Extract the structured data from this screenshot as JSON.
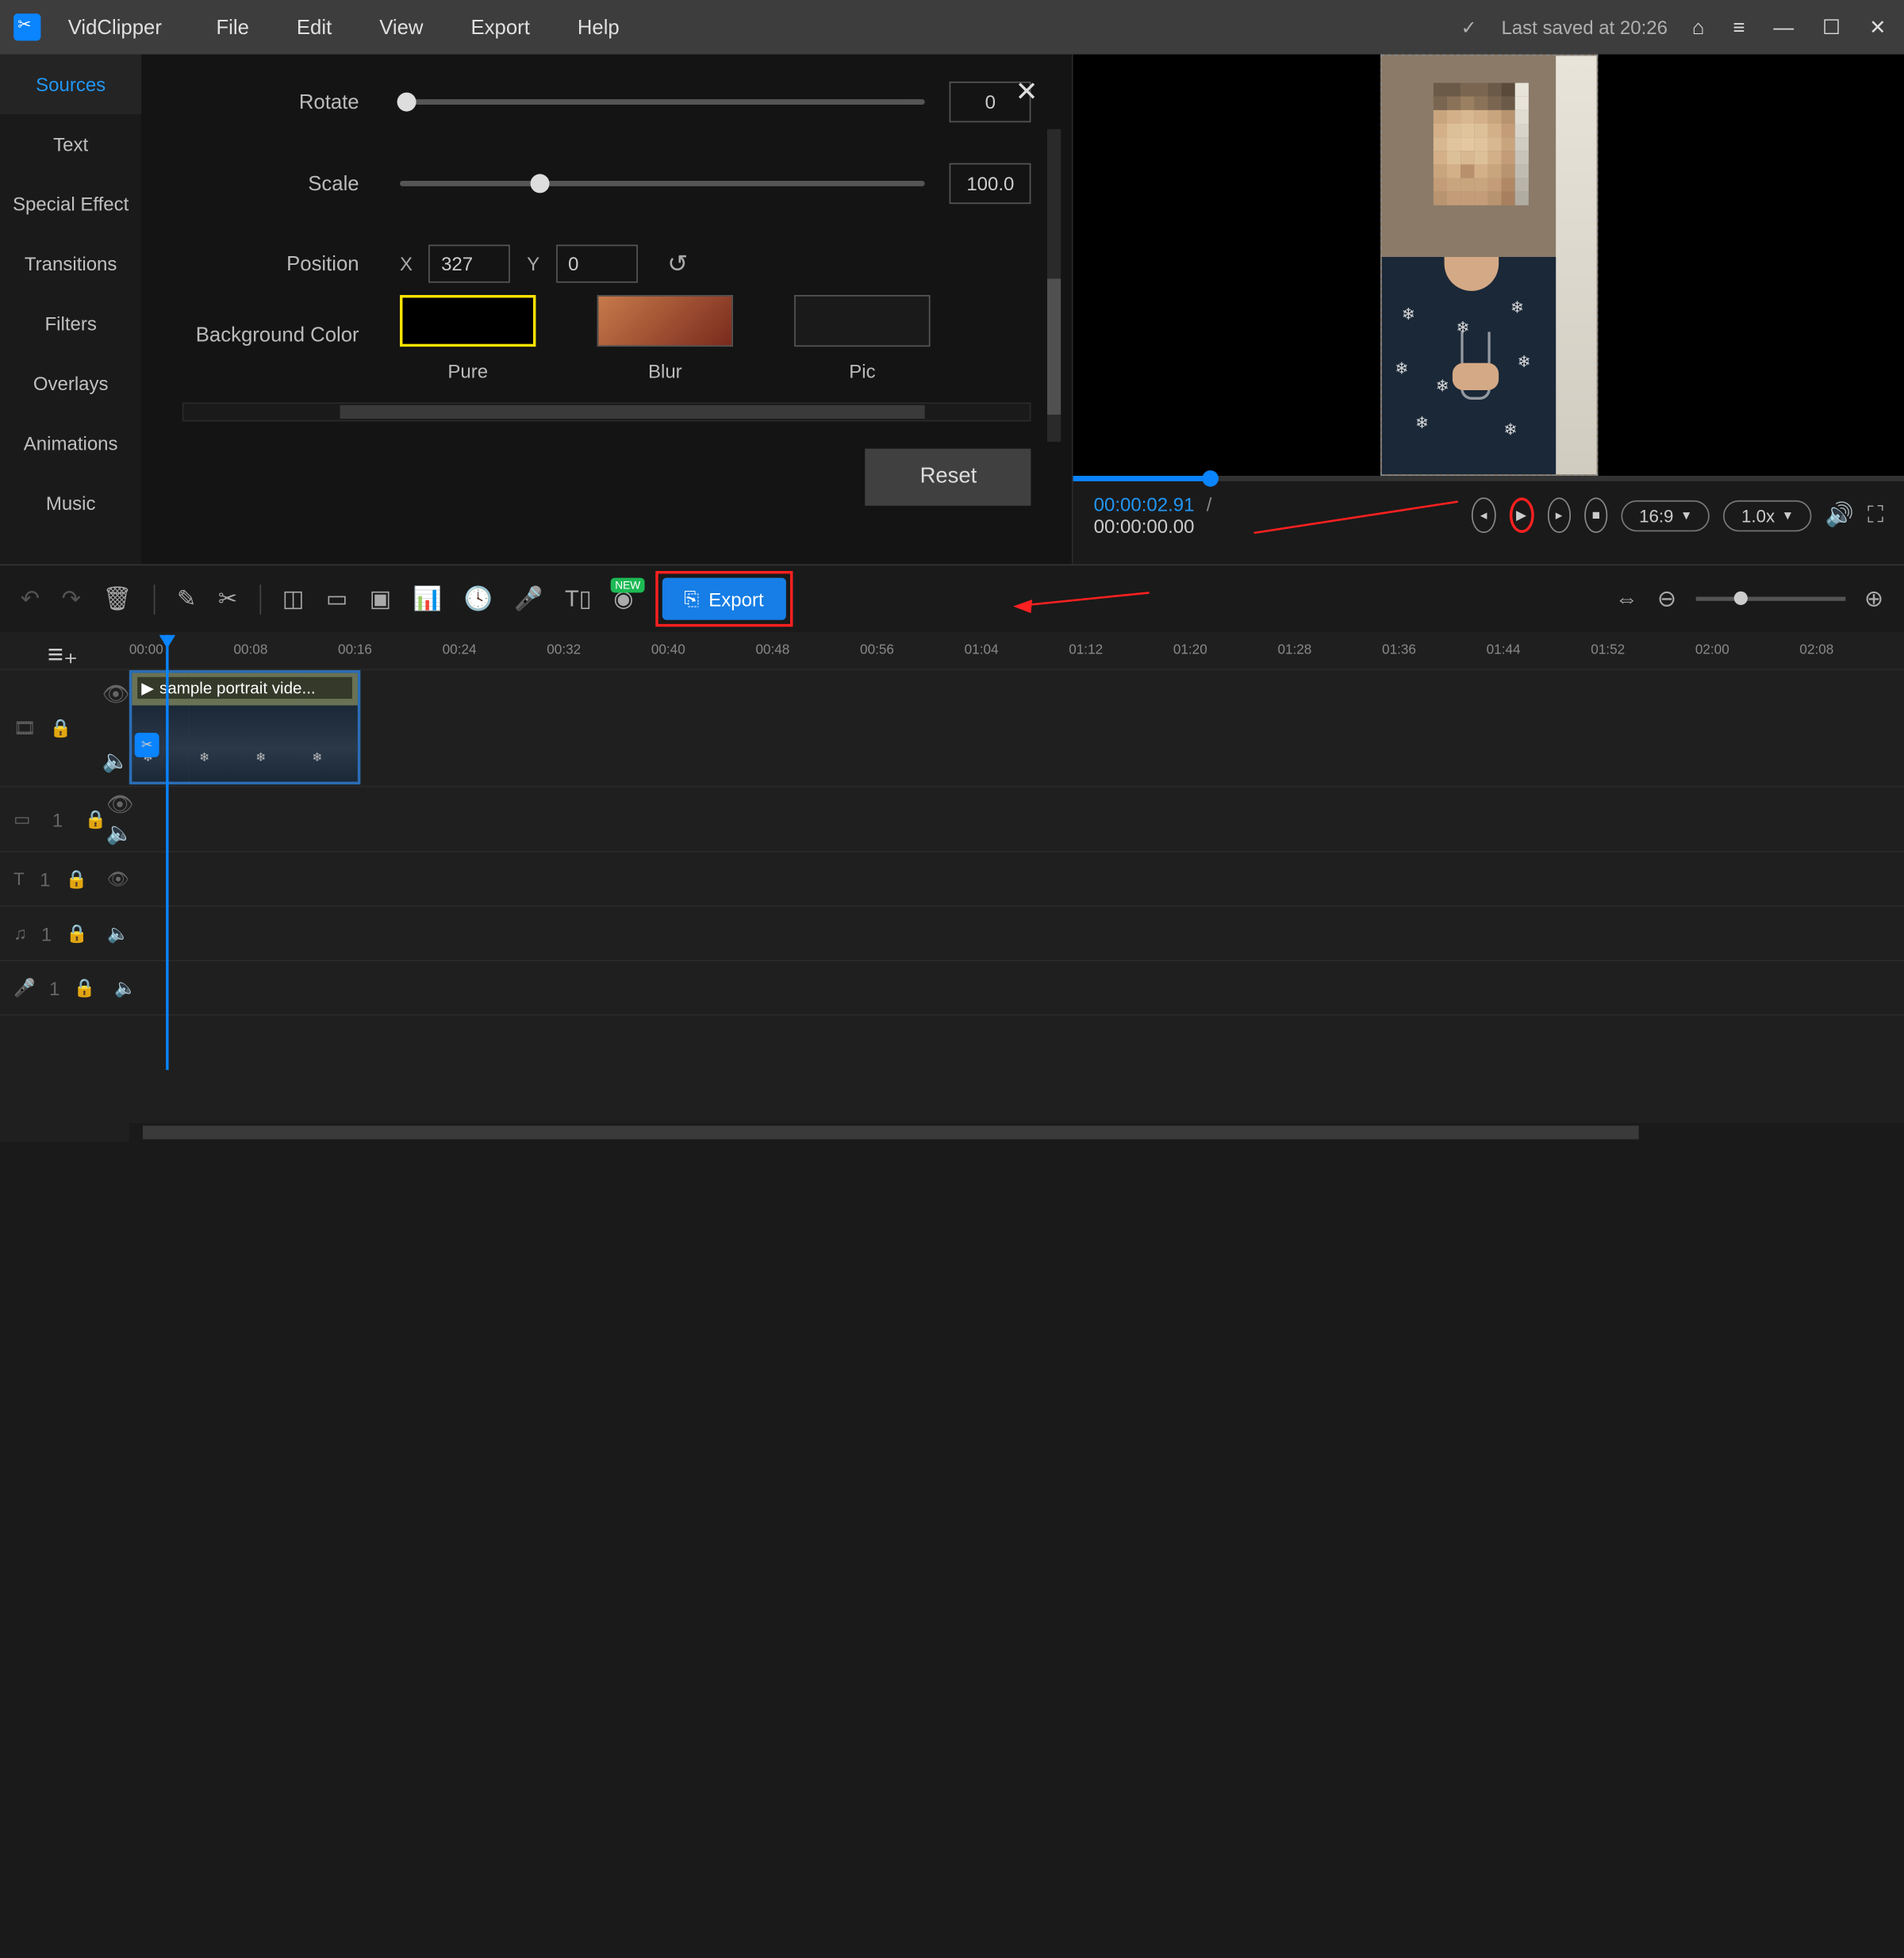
{
  "app": {
    "name": "VidClipper",
    "last_saved": "Last saved at 20:26"
  },
  "menu": [
    "File",
    "Edit",
    "View",
    "Export",
    "Help"
  ],
  "sidebar": {
    "items": [
      {
        "label": "Sources",
        "active": true
      },
      {
        "label": "Text"
      },
      {
        "label": "Special Effect"
      },
      {
        "label": "Transitions"
      },
      {
        "label": "Filters"
      },
      {
        "label": "Overlays"
      },
      {
        "label": "Animations"
      },
      {
        "label": "Music"
      }
    ]
  },
  "props": {
    "rotate": {
      "label": "Rotate",
      "value": "0"
    },
    "scale": {
      "label": "Scale",
      "value": "100.0"
    },
    "position": {
      "label": "Position",
      "x_label": "X",
      "x": "327",
      "y_label": "Y",
      "y": "0"
    },
    "bg": {
      "label": "Background Color",
      "opts": [
        "Pure",
        "Blur",
        "Pic"
      ]
    },
    "reset": "Reset"
  },
  "player": {
    "current": "00:00:02.91",
    "sep": "/",
    "total": "00:00:00.00",
    "ratio": "16:9",
    "speed": "1.0x"
  },
  "toolbar": {
    "export": "Export",
    "new": "NEW"
  },
  "timeline": {
    "ticks": [
      "00:00",
      "00:08",
      "00:16",
      "00:24",
      "00:32",
      "00:40",
      "00:48",
      "00:56",
      "01:04",
      "01:12",
      "01:20",
      "01:28",
      "01:36",
      "01:44",
      "01:52",
      "02:00",
      "02:08"
    ],
    "clip_title": "sample portrait vide...",
    "track_badges": {
      "one": "1"
    }
  }
}
